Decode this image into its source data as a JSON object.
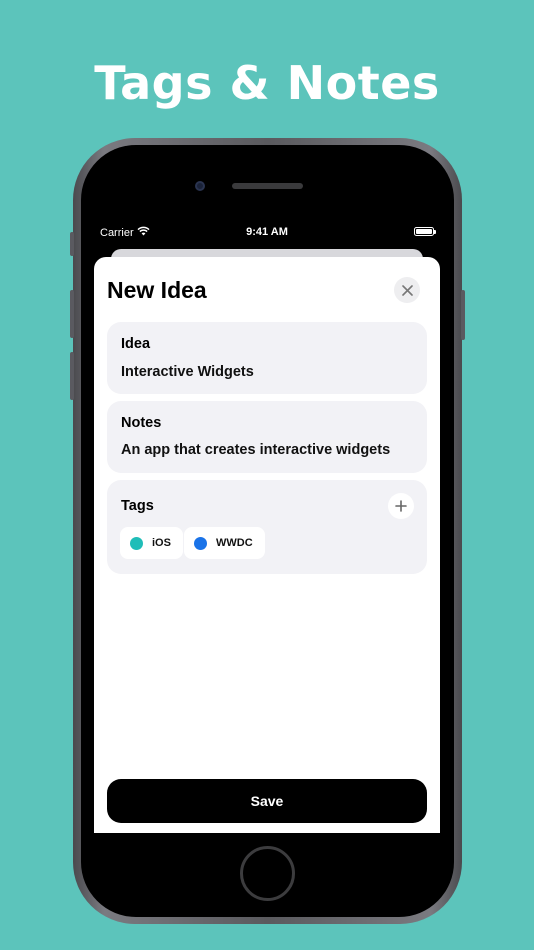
{
  "headline": "Tags & Notes",
  "status_bar": {
    "carrier": "Carrier",
    "time": "9:41 AM"
  },
  "sheet": {
    "title": "New Idea",
    "idea": {
      "label": "Idea",
      "value": "Interactive Widgets"
    },
    "notes": {
      "label": "Notes",
      "value": "An app that creates interactive widgets"
    },
    "tags": {
      "label": "Tags",
      "items": [
        {
          "label": "iOS",
          "color": "#1fbdb8"
        },
        {
          "label": "WWDC",
          "color": "#1a73e8"
        }
      ]
    },
    "save_label": "Save"
  },
  "icons": {
    "close": "close-icon",
    "add": "plus-icon",
    "wifi": "wifi-icon",
    "battery": "battery-icon"
  },
  "colors": {
    "background": "#5cc4bb",
    "field_bg": "#f2f2f6",
    "save_bg": "#000000"
  }
}
